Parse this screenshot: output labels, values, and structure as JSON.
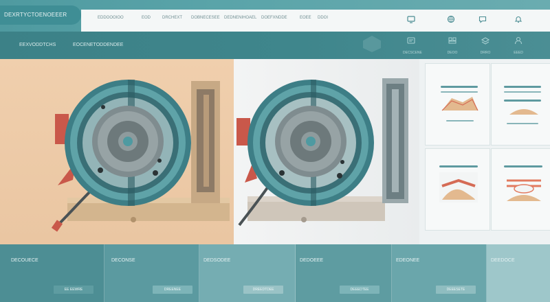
{
  "app": {
    "brand": "DEXRTYCTOENOEEER"
  },
  "nav": {
    "items": [
      "EDDOOOIOO",
      "EOD",
      "DRCHEXT",
      "DOBNECESEE",
      "DEDNENIHOAEL",
      "DOEFXNDDE",
      "EOEE",
      "DDOI"
    ]
  },
  "toolbar": {
    "left_label": "EEXVODDTCHS",
    "mid_label": "EOCENETODDENDEE",
    "icons": [
      {
        "name": "settings-icon",
        "label": "DECSCENE"
      },
      {
        "name": "grid-icon",
        "label": "DEOO"
      },
      {
        "name": "layers-icon",
        "label": "DRRO"
      },
      {
        "name": "user-icon",
        "label": "EEED"
      }
    ]
  },
  "bottom_tiles": [
    {
      "title": "DECOUECE",
      "button": "EE EEWRE"
    },
    {
      "title": "DECONSE",
      "button": "DREENEE"
    },
    {
      "title": "DEDSODEE",
      "button": "DREEDTDEE"
    },
    {
      "title": "DEDOEEE",
      "button": "DEEEDTEE"
    },
    {
      "title": "EDEONEE",
      "button": "DEEESETE"
    },
    {
      "title": "DEEDOCE",
      "button": ""
    }
  ],
  "colors": {
    "teal_dark": "#3c8187",
    "teal": "#4f9aa0",
    "peach": "#eac6a2",
    "accent_red": "#c9584a",
    "tan": "#c9ad88"
  }
}
